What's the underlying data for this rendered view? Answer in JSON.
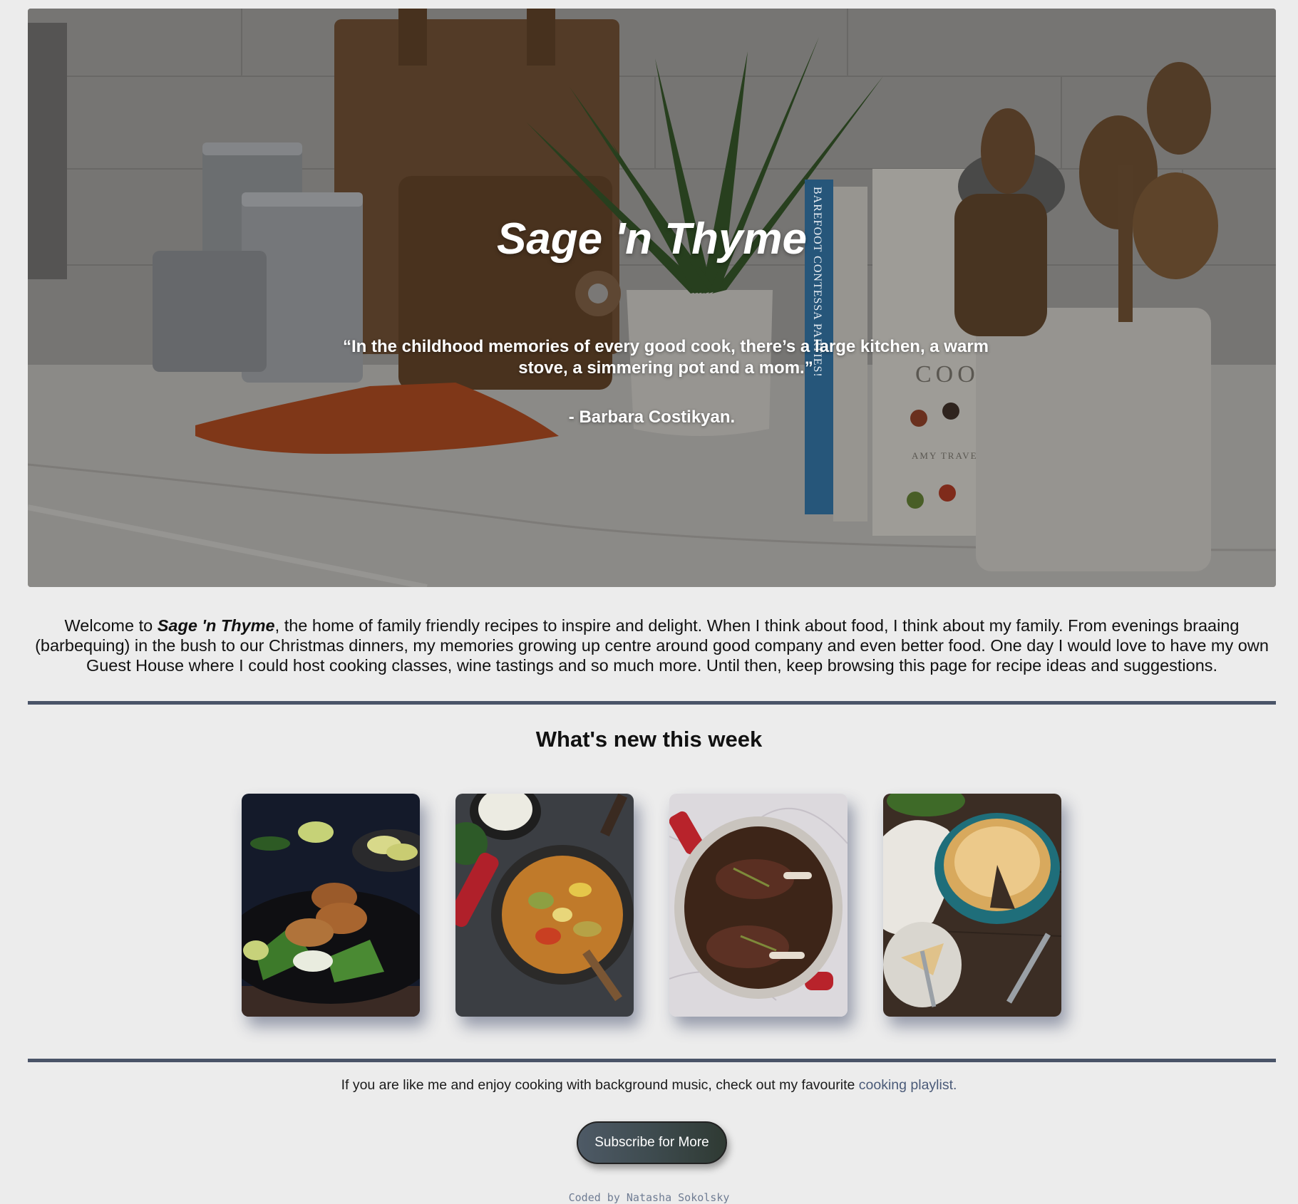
{
  "hero": {
    "title": "Sage 'n Thyme",
    "quote": "“In the childhood memories of every good cook, there’s a large kitchen, a warm stove, a simmering pot and a mom.”",
    "author": "- Barbara Costikyan.",
    "book_spine_text": "BAREFOOT CONTESSA PARTIES!",
    "book_cover_text": "COO",
    "book_author_text": "AMY TRAVE"
  },
  "intro": {
    "prefix": "Welcome to ",
    "brand": "Sage 'n Thyme",
    "body": ", the home of family friendly recipes to inspire and delight. When I think about food, I think about my family. From evenings braaing (barbequing) in the bush to our Christmas dinners, my memories growing up centre around good company and even better food. One day I would love to have my own Guest House where I could host cooking classes, wine tastings and so much more. Until then, keep browsing this page for recipe ideas and suggestions."
  },
  "section": {
    "title": "What's new this week"
  },
  "cards": [
    {
      "icon": "fishcakes-salad-photo"
    },
    {
      "icon": "vegetable-curry-photo"
    },
    {
      "icon": "braised-lamb-shanks-photo"
    },
    {
      "icon": "baked-cheesecake-photo"
    }
  ],
  "footer": {
    "playlist_text": "If you are like me and enjoy cooking with background music, check out my favourite ",
    "playlist_link": "cooking playlist.",
    "subscribe_label": "Subscribe for More",
    "credit": "Coded by Natasha Sokolsky"
  },
  "colors": {
    "page_bg": "#ececec",
    "divider": "#4a5468",
    "link": "#4a5a78",
    "button": "#3e4b4f",
    "credit": "#6f7c93"
  }
}
